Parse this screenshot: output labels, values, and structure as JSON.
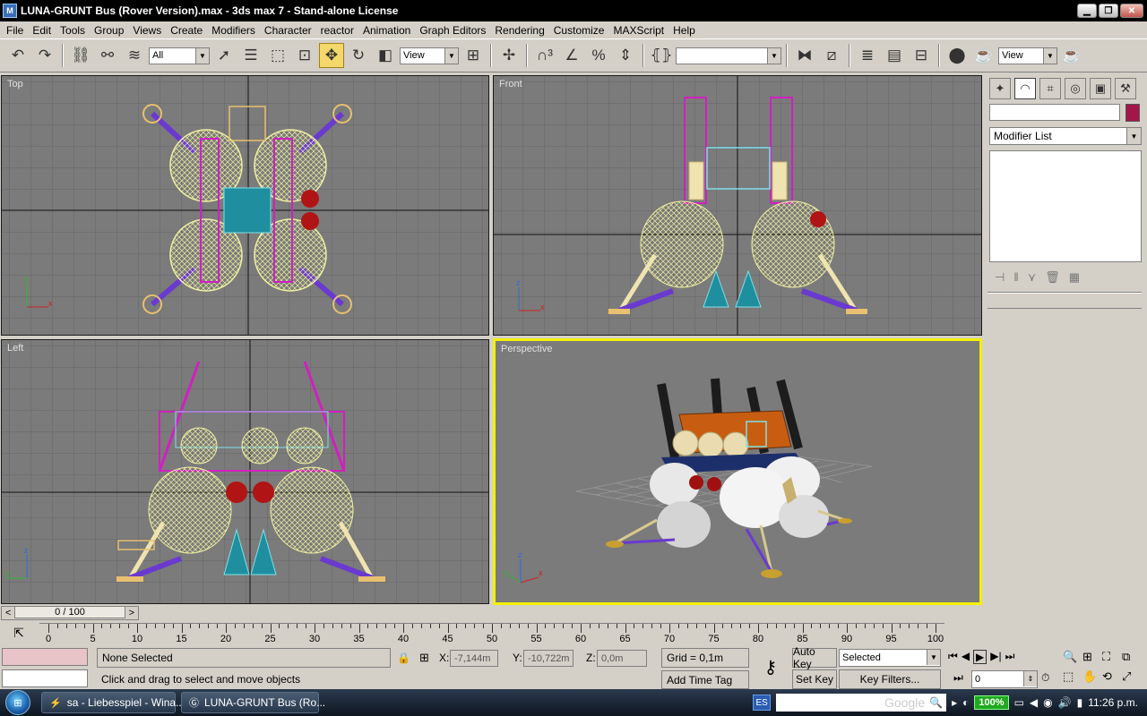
{
  "window": {
    "title": "LUNA-GRUNT Bus (Rover Version).max - 3ds max 7  - Stand-alone License",
    "app_icon": "3ds-max-icon"
  },
  "menu": [
    "File",
    "Edit",
    "Tools",
    "Group",
    "Views",
    "Create",
    "Modifiers",
    "Character",
    "reactor",
    "Animation",
    "Graph Editors",
    "Rendering",
    "Customize",
    "MAXScript",
    "Help"
  ],
  "toolbar": {
    "selection_filter": "All",
    "ref_coord": "View",
    "named_selection": "",
    "render_view": "View"
  },
  "viewports": {
    "top": "Top",
    "front": "Front",
    "left": "Left",
    "perspective": "Perspective"
  },
  "command_panel": {
    "object_name": "",
    "object_color": "#a3164a",
    "modifier_list": "Modifier List"
  },
  "time": {
    "frame_display": "0 / 100",
    "track_ticks": [
      "0",
      "5",
      "10",
      "15",
      "20",
      "25",
      "30",
      "35",
      "40",
      "45",
      "50",
      "55",
      "60",
      "65",
      "70",
      "75",
      "80",
      "85",
      "90",
      "95",
      "100"
    ]
  },
  "status": {
    "selection": "None Selected",
    "prompt": "Click and drag to select and move objects",
    "x_label": "X:",
    "x_value": "-7,144m",
    "y_label": "Y:",
    "y_value": "-10,722m",
    "z_label": "Z:",
    "z_value": "0,0m",
    "grid": "Grid = 0,1m",
    "add_time_tag": "Add Time Tag",
    "auto_key": "Auto Key",
    "set_key": "Set Key",
    "key_mode": "Selected",
    "key_filters": "Key Filters...",
    "current_frame": "0"
  },
  "taskbar": {
    "tasks": [
      "sa - Liebesspiel - Wina...",
      "LUNA-GRUNT Bus (Ro..."
    ],
    "language": "ES",
    "search_placeholder": "Google",
    "battery": "100%",
    "clock": "11:26 p.m."
  }
}
